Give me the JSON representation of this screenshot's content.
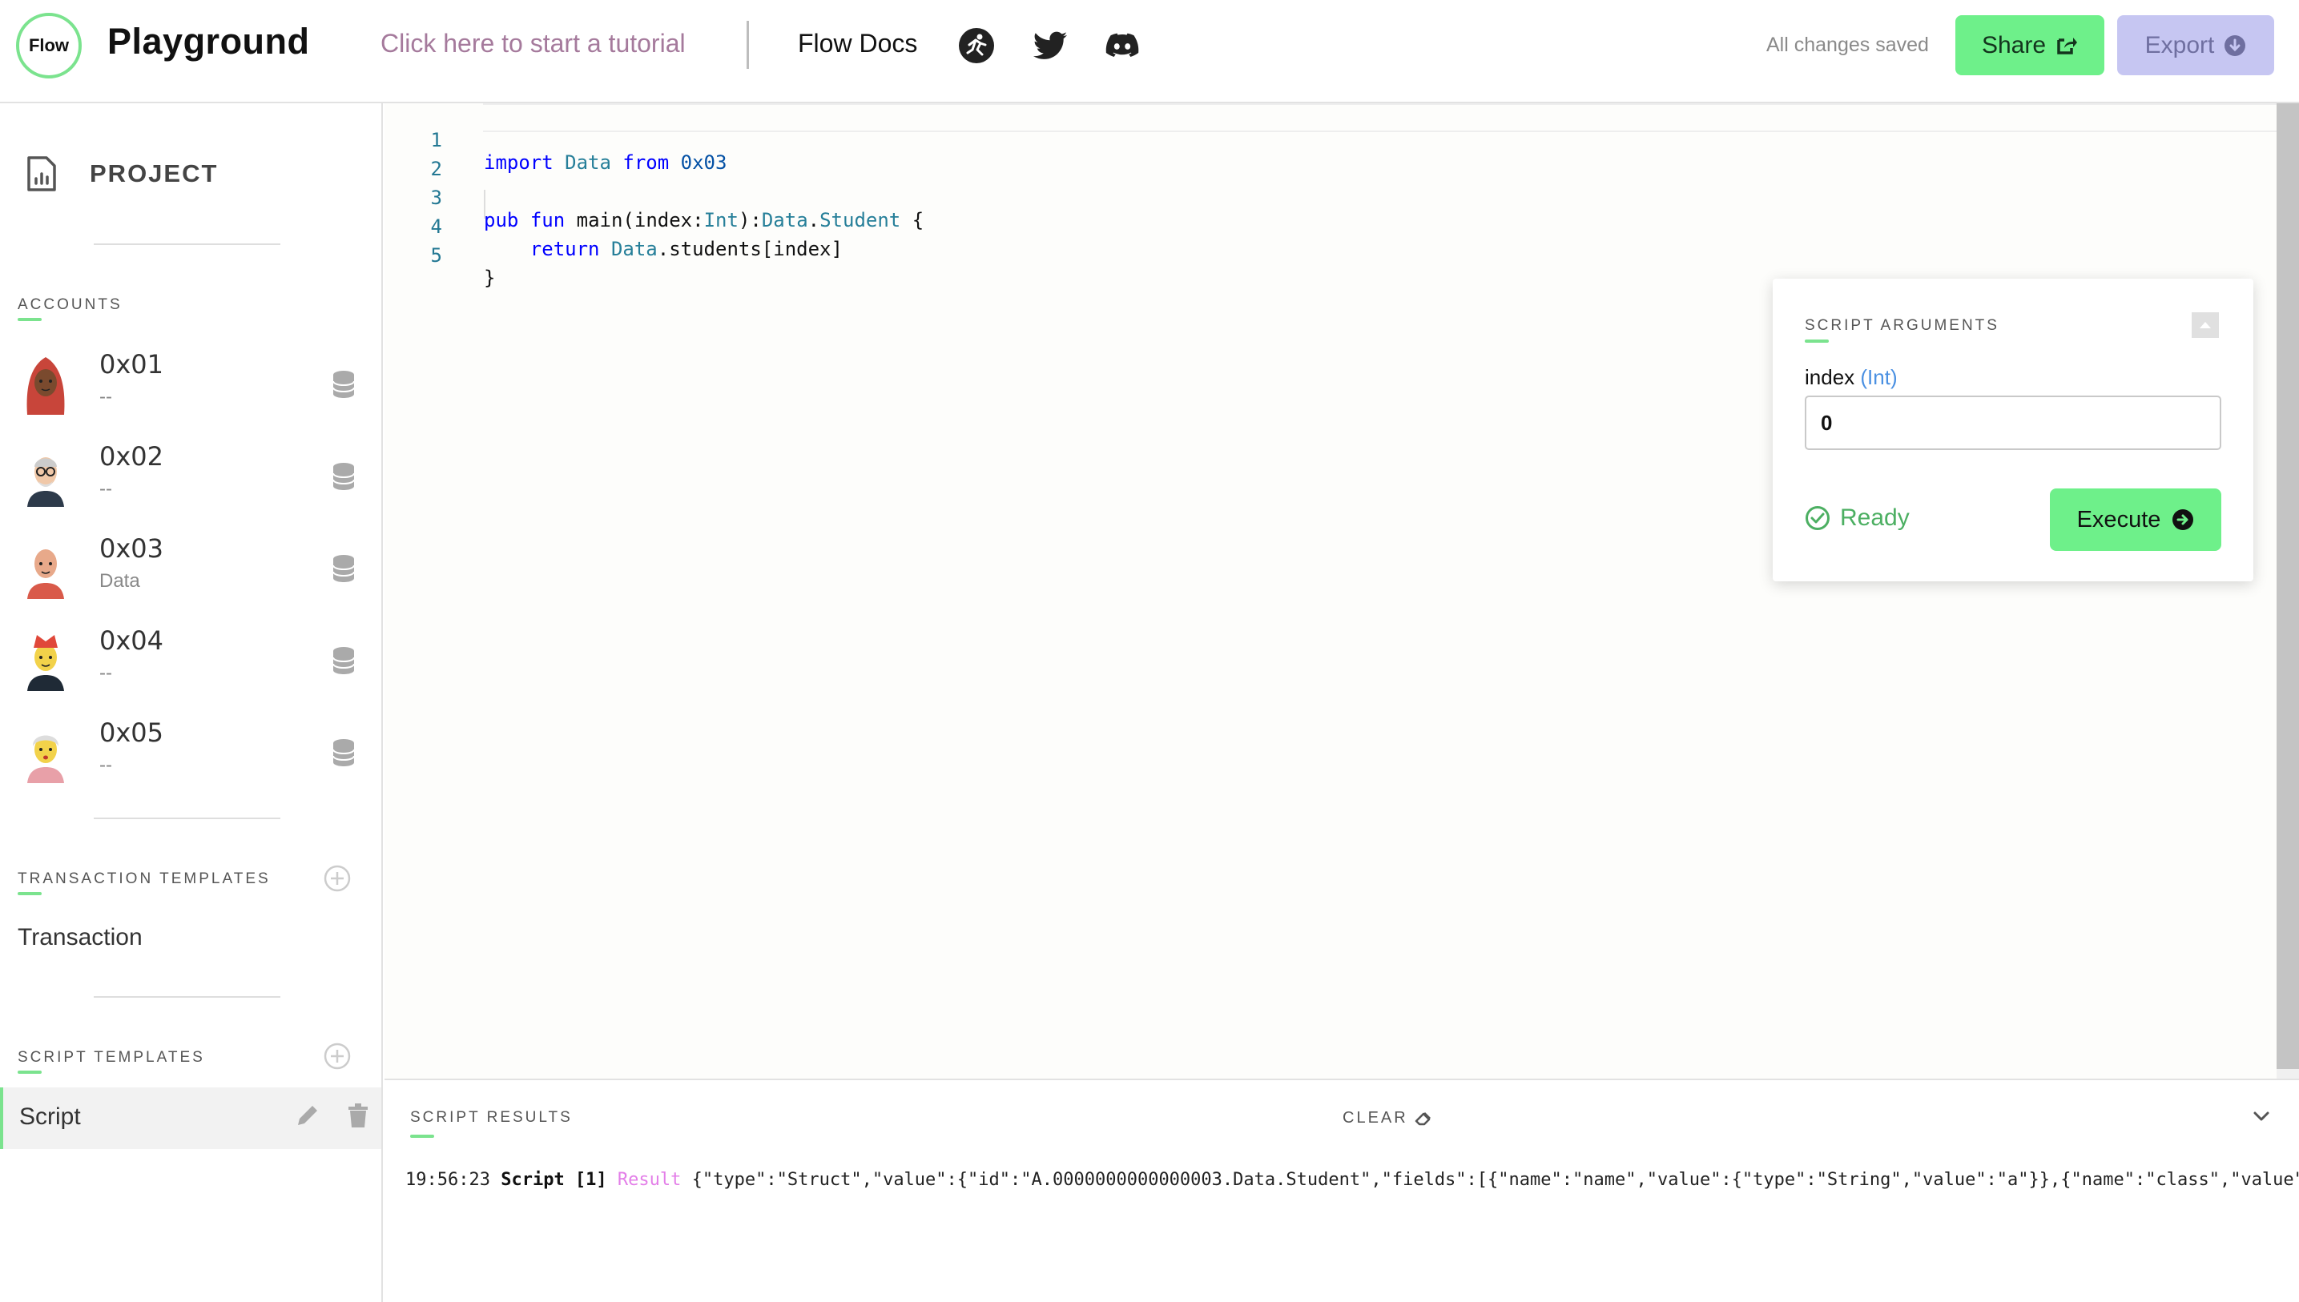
{
  "header": {
    "logo_text": "Flow",
    "title": "Playground",
    "tutorial_link": "Click here to start a tutorial",
    "docs_link": "Flow Docs",
    "social_icons": [
      "flow-runner-icon",
      "twitter-icon",
      "discord-icon"
    ],
    "save_status": "All changes saved",
    "share_label": "Share",
    "export_label": "Export"
  },
  "sidebar": {
    "project_label": "PROJECT",
    "accounts_title": "ACCOUNTS",
    "accounts": [
      {
        "address": "0x01",
        "contract": "--"
      },
      {
        "address": "0x02",
        "contract": "--"
      },
      {
        "address": "0x03",
        "contract": "Data"
      },
      {
        "address": "0x04",
        "contract": "--"
      },
      {
        "address": "0x05",
        "contract": "--"
      }
    ],
    "transaction_templates_title": "TRANSACTION TEMPLATES",
    "transactions": [
      "Transaction"
    ],
    "script_templates_title": "SCRIPT TEMPLATES",
    "scripts": [
      "Script"
    ]
  },
  "editor": {
    "lines": [
      {
        "num": "1"
      },
      {
        "num": "2"
      },
      {
        "num": "3"
      },
      {
        "num": "4"
      },
      {
        "num": "5"
      }
    ],
    "tokens": {
      "l1_kw1": "import",
      "l1_ty": "Data",
      "l1_kw2": "from",
      "l1_num": "0x03",
      "l3_kw1": "pub",
      "l3_kw2": "fun",
      "l3_fn": "main(index:",
      "l3_ty1": "Int",
      "l3_p": "):",
      "l3_ty2": "Data",
      "l3_dot": ".",
      "l3_ty3": "Student",
      "l3_brace": " {",
      "l4_kw": "return",
      "l4_ty": "Data",
      "l4_rest": ".students[index]",
      "l5_brace": "}"
    }
  },
  "arguments": {
    "title": "SCRIPT ARGUMENTS",
    "arg_name": "index",
    "arg_type": "(Int)",
    "arg_value": "0",
    "status": "Ready",
    "execute_label": "Execute"
  },
  "results": {
    "title": "SCRIPT RESULTS",
    "clear_label": "CLEAR",
    "log": {
      "time": "19:56:23",
      "type": "Script [1]",
      "label": "Result",
      "value": "{\"type\":\"Struct\",\"value\":{\"id\":\"A.0000000000000003.Data.Student\",\"fields\":[{\"name\":\"name\",\"value\":{\"type\":\"String\",\"value\":\"a\"}},{\"name\":\"class\",\"value\""
    }
  },
  "colors": {
    "accent_green": "#6ef08a",
    "export_bg": "#c6c6f2",
    "tutorial_text": "#a57a9c",
    "ready_green": "#4caf62",
    "keyword_blue": "#0000ff",
    "type_teal": "#267f99",
    "result_pink": "#e37ee8"
  }
}
